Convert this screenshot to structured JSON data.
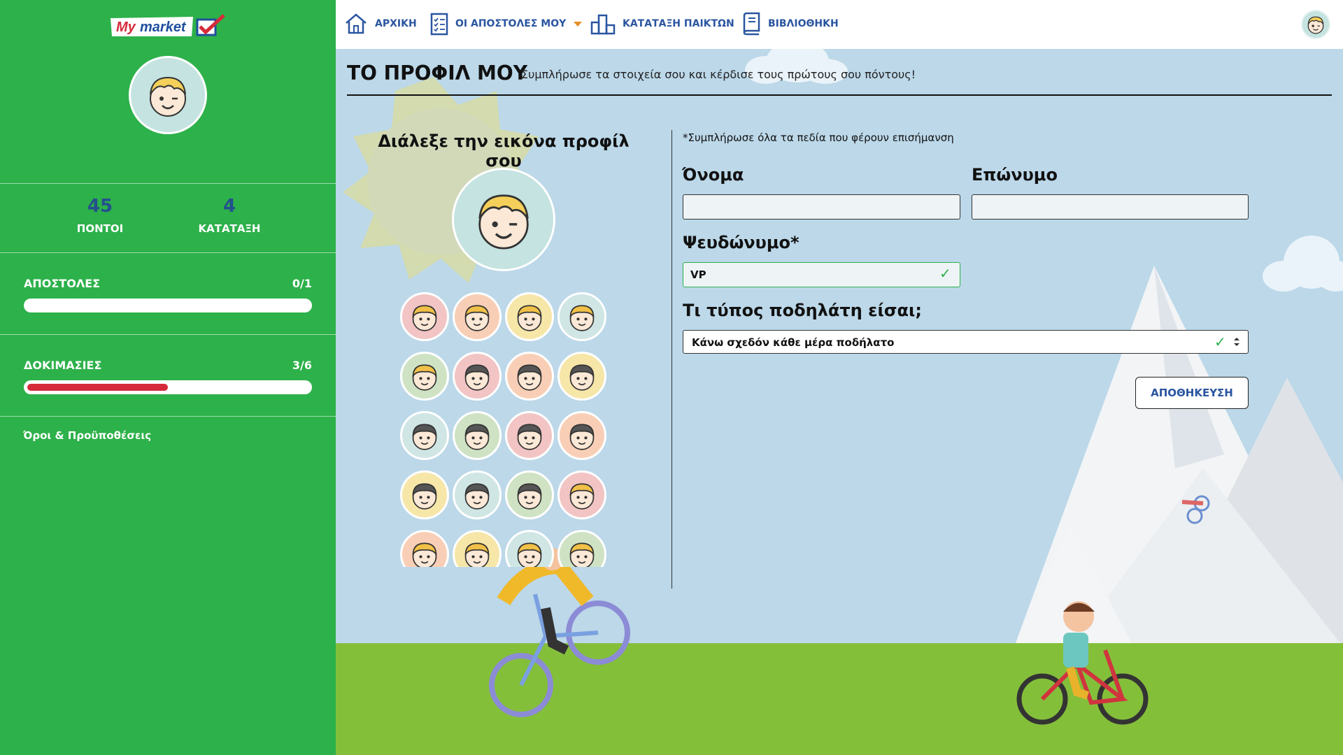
{
  "sidebar": {
    "logo_text": "My market",
    "stats": [
      {
        "value": "45",
        "label": "ΠΟΝΤΟΙ"
      },
      {
        "value": "4",
        "label": "ΚΑΤΑΤΑΞΗ"
      }
    ],
    "progress": [
      {
        "label": "ΑΠΟΣΤΟΛΕΣ",
        "value": "0/1",
        "fraction": 0.0
      },
      {
        "label": "ΔΟΚΙΜΑΣΙΕΣ",
        "value": "3/6",
        "fraction": 0.5
      }
    ],
    "terms_link": "Όροι & Προϋποθέσεις"
  },
  "nav": {
    "home": "ΑΡΧΙΚΗ",
    "missions": "ΟΙ ΑΠΟΣΤΟΛΕΣ ΜΟΥ",
    "ranking": "ΚΑΤΑΤΑΞΗ ΠΑΙΚΤΩΝ",
    "library": "ΒΙΒΛΙΟΘΗΚΗ"
  },
  "page": {
    "title": "ΤΟ ΠΡΟΦΙΛ ΜΟΥ",
    "subtitle": "Συμπλήρωσε τα στοιχεία σου και κέρδισε τους πρώτους σου πόντους!"
  },
  "avatar_picker": {
    "title": "Διάλεξε την εικόνα προφίλ σου",
    "avatars": [
      {
        "bg": "#f2c4c4",
        "hair": "#f0c048"
      },
      {
        "bg": "#f8cfb6",
        "hair": "#f0c048"
      },
      {
        "bg": "#f6e6a8",
        "hair": "#f0c048"
      },
      {
        "bg": "#cfe6e4",
        "hair": "#f0c048"
      },
      {
        "bg": "#cfe3c4",
        "hair": "#f0c048"
      },
      {
        "bg": "#f2c4c4",
        "hair": "#555555"
      },
      {
        "bg": "#f8cfb6",
        "hair": "#555555"
      },
      {
        "bg": "#f6e6a8",
        "hair": "#555555"
      },
      {
        "bg": "#cfe6e4",
        "hair": "#555555"
      },
      {
        "bg": "#cfe3c4",
        "hair": "#555555"
      },
      {
        "bg": "#f2c4c4",
        "hair": "#555555"
      },
      {
        "bg": "#f8cfb6",
        "hair": "#555555"
      },
      {
        "bg": "#f6e6a8",
        "hair": "#555555"
      },
      {
        "bg": "#cfe6e4",
        "hair": "#555555"
      },
      {
        "bg": "#cfe3c4",
        "hair": "#555555"
      },
      {
        "bg": "#f2c4c4",
        "hair": "#f0c048"
      },
      {
        "bg": "#f8cfb6",
        "hair": "#f0c048"
      },
      {
        "bg": "#f6e6a8",
        "hair": "#f0c048"
      },
      {
        "bg": "#cfe6e4",
        "hair": "#f0c048"
      },
      {
        "bg": "#cfe3c4",
        "hair": "#f0c048"
      }
    ]
  },
  "form": {
    "required_note": "*Συμπλήρωσε όλα τα πεδία που φέρουν επισήμανση",
    "first_name_label": "Όνομα",
    "first_name_value": "",
    "last_name_label": "Επώνυμο",
    "last_name_value": "",
    "nickname_label": "Ψευδώνυμο*",
    "nickname_value": "VP",
    "cyclist_type_label": "Τι τύπος ποδηλάτη είσαι;",
    "cyclist_type_value": "Κάνω σχεδόν κάθε μέρα ποδήλατο",
    "save_button": "ΑΠΟΘΗΚΕΥΣΗ"
  },
  "colors": {
    "sidebar_green": "#2db14a",
    "nav_blue": "#2a55a0",
    "progress_red": "#d52a3a",
    "sky": "#bcd8e9",
    "grass": "#84bf3a"
  }
}
